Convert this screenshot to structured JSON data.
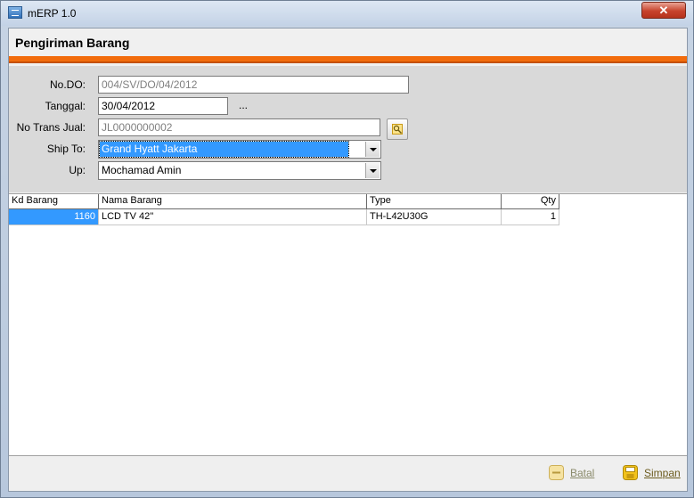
{
  "window": {
    "title": "mERP 1.0",
    "close_glyph": "✕"
  },
  "form": {
    "title": "Pengiriman Barang"
  },
  "fields": {
    "no_do": {
      "label": "No.DO:",
      "value": "004/SV/DO/04/2012"
    },
    "tanggal": {
      "label": "Tanggal:",
      "value": "30/04/2012",
      "picker": "..."
    },
    "no_trans_jual": {
      "label": "No Trans Jual:",
      "value": "JL0000000002"
    },
    "ship_to": {
      "label": "Ship To:",
      "value": "Grand Hyatt Jakarta"
    },
    "up": {
      "label": "Up:",
      "value": "Mochamad Amin"
    }
  },
  "grid": {
    "columns": [
      "Kd Barang",
      "Nama Barang",
      "Type",
      "Qty"
    ],
    "rows": [
      {
        "kd_barang": "1160",
        "nama_barang": "LCD TV 42''",
        "type": "TH-L42U30G",
        "qty": "1"
      }
    ]
  },
  "footer": {
    "batal_label": "Batal",
    "simpan_label": "Simpan"
  },
  "colors": {
    "accent_bar": "#f26c0d",
    "selection": "#3399ff"
  }
}
